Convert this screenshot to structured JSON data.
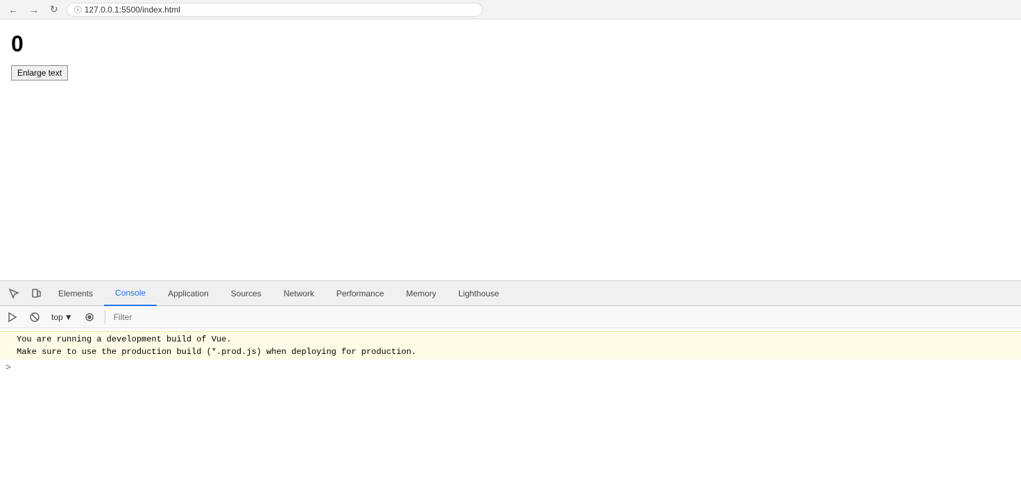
{
  "browser": {
    "url": "127.0.0.1:5500/index.html",
    "nav": {
      "back_label": "←",
      "forward_label": "→",
      "reload_label": "↻",
      "info_label": "ⓘ"
    }
  },
  "page": {
    "counter": "0",
    "enlarge_button_label": "Enlarge text"
  },
  "devtools": {
    "tabs": [
      {
        "label": "Elements",
        "active": false
      },
      {
        "label": "Console",
        "active": true
      },
      {
        "label": "Application",
        "active": false
      },
      {
        "label": "Sources",
        "active": false
      },
      {
        "label": "Network",
        "active": false
      },
      {
        "label": "Performance",
        "active": false
      },
      {
        "label": "Memory",
        "active": false
      },
      {
        "label": "Lighthouse",
        "active": false
      }
    ],
    "console": {
      "context": "top",
      "filter_placeholder": "Filter",
      "messages": [
        {
          "text": "You are running a development build of Vue.\nMake sure to use the production build (*.prod.js) when deploying for production."
        }
      ],
      "prompt": ">"
    }
  }
}
